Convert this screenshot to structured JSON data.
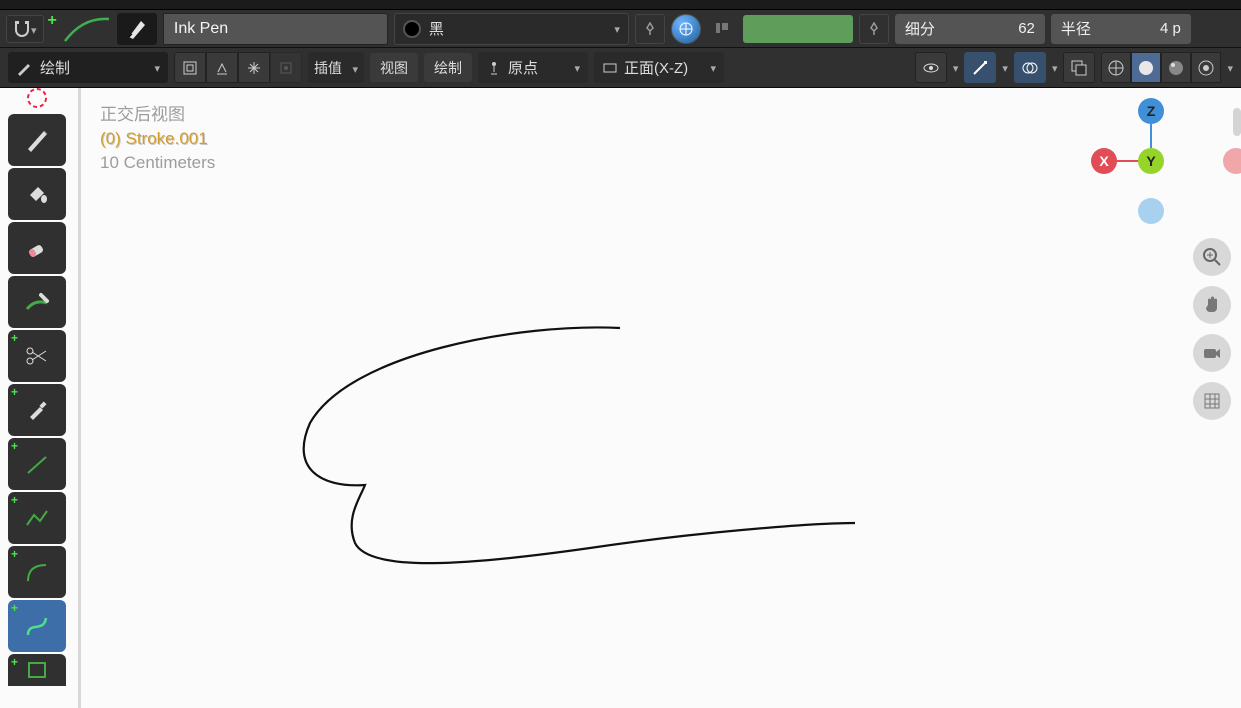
{
  "topbar": {
    "brush_name": "Ink Pen",
    "color_label": "黑",
    "subdiv_label": "细分",
    "subdiv_value": "62",
    "radius_label": "半径",
    "radius_value": "4 p"
  },
  "modebar": {
    "mode_label": "绘制",
    "interp_label": "插值",
    "view_label": "视图",
    "draw_label": "绘制",
    "orient_label": "原点",
    "plane_label": "正面(X-Z)"
  },
  "overlay": {
    "projection": "正交后视图",
    "layer": "(0) Stroke.001",
    "grid": "10 Centimeters"
  },
  "gizmo": {
    "x": "X",
    "y": "Y",
    "z": "Z"
  }
}
